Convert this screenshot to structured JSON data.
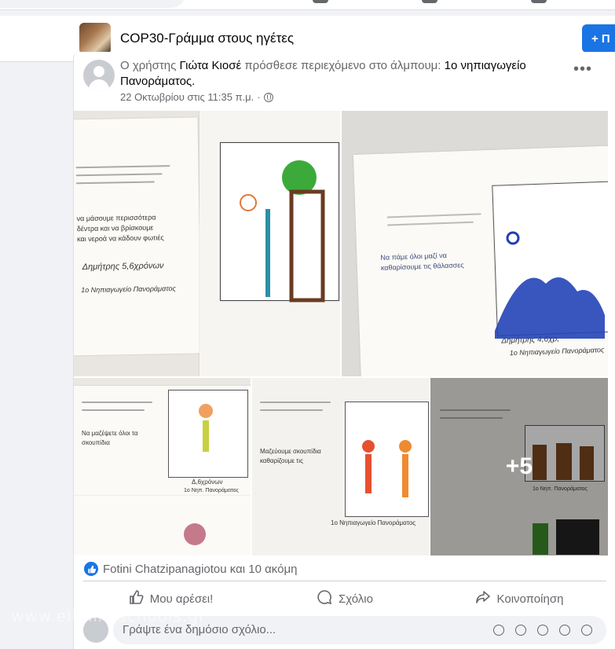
{
  "group": {
    "title": "COP30-Γράμμα στους ηγέτες",
    "join_label": "+ Π"
  },
  "post": {
    "prefix": "Ο χρήστης ",
    "author": "Γιώτα Κιοσέ",
    "middle": " πρόσθεσε περιεχόμενο στο άλμπουμ: ",
    "album": "1ο νηπιαγωγείο Πανοράματος",
    "suffix": ".",
    "timestamp": "22 Οκτωβρίου στις 11:35 π.μ.",
    "separator": "·",
    "more_label": "•••",
    "more_photos": "+5"
  },
  "photos": [
    {
      "caption_name": "Δημήτρης 5,6χρόνων",
      "caption_school": "1ο Νηπιαγωγείο Πανοράματος",
      "text_lines": [
        "να μάσουμε περισσότερα",
        "δέντρα και να βρίσκουμε",
        "και νεροά να κάδουν φωτιές"
      ]
    },
    {
      "caption_name": "Δημήτρης 4,6χρ,",
      "caption_school": "1ο Νηπιαγωγείο Πανοράματος",
      "text_lines": [
        "Να πάμε όλοι μαζί να",
        "καθαρίσουμε τις θάλασσες"
      ]
    },
    {
      "caption_name": "Δ,6χρόνων",
      "caption_school": "1ο Νηπ. Πανοράματος",
      "text_lines": [
        "Να μαζέψετε όλοι τα",
        "σκουπίδια"
      ]
    },
    {
      "caption_name": "",
      "caption_school": "1ο Νηπιαγωγείο Πανοράματος",
      "text_lines": [
        "Μαζεύουμε σκουπίδια",
        "καθαρίζουμε τις"
      ]
    },
    {
      "caption_name": "",
      "caption_school": "1ο Νηπ. Πανοράματος",
      "text_lines": []
    }
  ],
  "engagement": {
    "reactors": "Fotini Chatzipanagiotou και 10 ακόμη"
  },
  "actions": {
    "like": "Μου αρέσει!",
    "comment": "Σχόλιο",
    "share": "Κοινοποίηση"
  },
  "comment": {
    "placeholder": "Γράψτε ένα δημόσιο σχόλιο..."
  },
  "watermark": "www.ellinikaschools.gr",
  "colors": {
    "accent": "#1b74e4",
    "page_bg": "#f0f2f5",
    "muted_text": "#65676b"
  },
  "icons": [
    "like-icon",
    "comment-icon",
    "share-icon",
    "globe-icon",
    "more-options-icon"
  ]
}
